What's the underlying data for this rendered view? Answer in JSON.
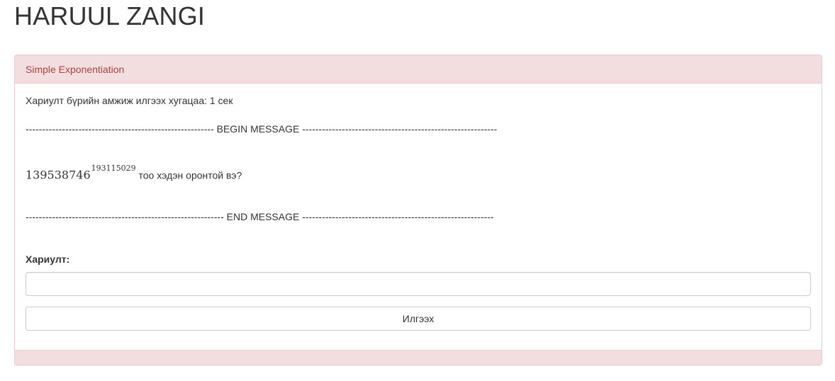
{
  "header": {
    "title": "HARUUL ZANGI"
  },
  "panel": {
    "heading": "Simple Exponentiation",
    "timeout_text": "Хариулт бүрийн амжиж илгээх хугацаа: 1 сек",
    "begin_message": "--------------------------------------------------------- BEGIN MESSAGE -----------------------------------------------------------",
    "question": {
      "base": "139538746",
      "exponent": "193115029",
      "text": " тоо хэдэн оронтой вэ?"
    },
    "end_message": "------------------------------------------------------------ END MESSAGE ----------------------------------------------------------",
    "answer_label": "Хариулт:",
    "answer_value": "",
    "submit_label": "Илгээх"
  },
  "colors": {
    "panel_heading_bg": "#f2dede",
    "panel_heading_text": "#a94442",
    "panel_border": "#ebccd1"
  }
}
